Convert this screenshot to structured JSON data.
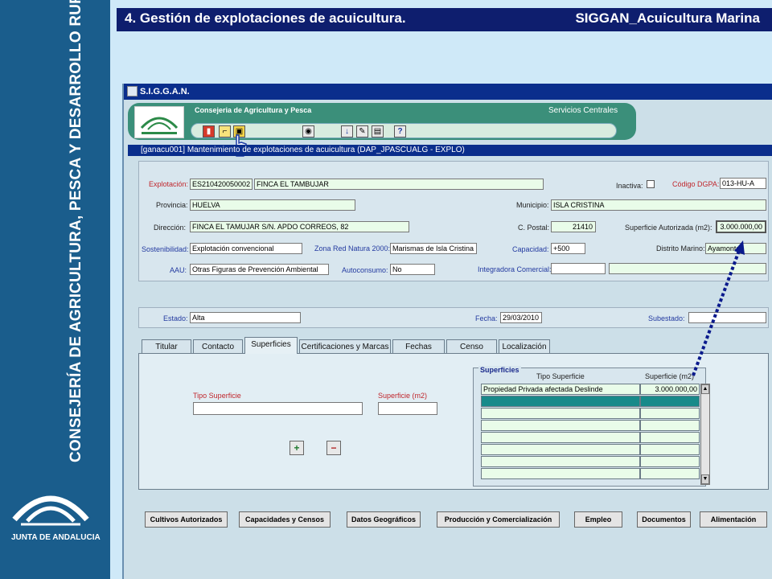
{
  "slide": {
    "title": "4. Gestión de explotaciones de acuicultura.",
    "subtitle": "SIGGAN_Acuicultura Marina",
    "sidebar_text": "CONSEJERÍA DE AGRICULTURA, PESCA Y DESARROLLO RURAL",
    "logo_text": "JUNTA DE ANDALUCIA"
  },
  "app": {
    "title": "S.I.G.G.A.N.",
    "org": "Consejeria de Agricultura y Pesca",
    "service": "Servicios Centrales",
    "form_title": "[ganacu001] Mantenimiento de explotaciones de acuicultura  (DAP_JPASCUALG - EXPLO)"
  },
  "form": {
    "explotacion_label": "Explotación:",
    "explotacion_code": "ES210420050002",
    "explotacion_name": "FINCA EL TAMBUJAR",
    "inactiva_label": "Inactiva:",
    "codigo_dgpa_label": "Código DGPA:",
    "codigo_dgpa": "013-HU-A",
    "provincia_label": "Provincia:",
    "provincia": "HUELVA",
    "municipio_label": "Municipio:",
    "municipio": "ISLA CRISTINA",
    "direccion_label": "Dirección:",
    "direccion": "FINCA EL TAMUJAR S/N. APDO CORREOS, 82",
    "cpostal_label": "C. Postal:",
    "cpostal": "21410",
    "superficie_aut_label": "Superficie Autorizada (m2):",
    "superficie_aut": "3.000.000,00",
    "sostenibilidad_label": "Sostenibilidad:",
    "sostenibilidad": "Explotación convencional",
    "zona_red_label": "Zona Red Natura 2000:",
    "zona_red": "Marismas de Isla Cristina",
    "capacidad_label": "Capacidad:",
    "capacidad": "+500",
    "distrito_label": "Distrito Marino:",
    "distrito": "Ayamonte",
    "aau_label": "AAU:",
    "aau": "Otras Figuras de Prevención Ambiental",
    "autoconsumo_label": "Autoconsumo:",
    "autoconsumo": "No",
    "integradora_label": "Integradora Comercial:",
    "integradora_code": "",
    "integradora_name": "",
    "estado_label": "Estado:",
    "estado": "Alta",
    "fecha_label": "Fecha:",
    "fecha": "29/03/2010",
    "subestado_label": "Subestado:",
    "subestado": ""
  },
  "tabs": [
    "Titular",
    "Contacto",
    "Superficies",
    "Certificaciones y Marcas",
    "Fechas",
    "Censo",
    "Localización"
  ],
  "superficies": {
    "tipo_label": "Tipo Superficie",
    "superficie_label": "Superficie (m2)",
    "tipo_value": "",
    "superficie_value": "",
    "grid_title": "Superficies",
    "col_tipo": "Tipo Superficie",
    "col_superficie": "Superficie (m2)",
    "rows": [
      {
        "tipo": "Propiedad Privada afectada Deslinde",
        "superficie": "3.000.000,00"
      }
    ]
  },
  "bottom_buttons": [
    "Cultivos Autorizados",
    "Capacidades y Censos",
    "Datos Geográficos",
    "Producción y Comercialización",
    "Empleo",
    "Documentos",
    "Alimentación"
  ],
  "colors": {
    "title_band": "#0e1e6e",
    "sidebar": "#1a5d8c",
    "banner": "#3b8f7a",
    "field_bg": "#e9fce9",
    "selected_row": "#188a8a",
    "arrow": "#0a1a8c"
  },
  "icons": [
    "door-icon",
    "open-folder-icon",
    "save-icon",
    "binoculars-icon",
    "download-icon",
    "edit-icon",
    "print-icon",
    "help-icon",
    "add-row-icon",
    "delete-row-icon",
    "hand-cursor-icon"
  ]
}
